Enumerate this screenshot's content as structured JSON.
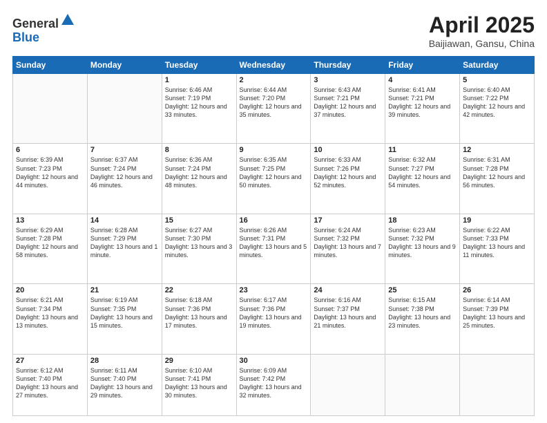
{
  "header": {
    "logo_general": "General",
    "logo_blue": "Blue",
    "month_title": "April 2025",
    "location": "Baijiawan, Gansu, China"
  },
  "weekdays": [
    "Sunday",
    "Monday",
    "Tuesday",
    "Wednesday",
    "Thursday",
    "Friday",
    "Saturday"
  ],
  "weeks": [
    [
      {
        "day": "",
        "sunrise": "",
        "sunset": "",
        "daylight": ""
      },
      {
        "day": "",
        "sunrise": "",
        "sunset": "",
        "daylight": ""
      },
      {
        "day": "1",
        "sunrise": "Sunrise: 6:46 AM",
        "sunset": "Sunset: 7:19 PM",
        "daylight": "Daylight: 12 hours and 33 minutes."
      },
      {
        "day": "2",
        "sunrise": "Sunrise: 6:44 AM",
        "sunset": "Sunset: 7:20 PM",
        "daylight": "Daylight: 12 hours and 35 minutes."
      },
      {
        "day": "3",
        "sunrise": "Sunrise: 6:43 AM",
        "sunset": "Sunset: 7:21 PM",
        "daylight": "Daylight: 12 hours and 37 minutes."
      },
      {
        "day": "4",
        "sunrise": "Sunrise: 6:41 AM",
        "sunset": "Sunset: 7:21 PM",
        "daylight": "Daylight: 12 hours and 39 minutes."
      },
      {
        "day": "5",
        "sunrise": "Sunrise: 6:40 AM",
        "sunset": "Sunset: 7:22 PM",
        "daylight": "Daylight: 12 hours and 42 minutes."
      }
    ],
    [
      {
        "day": "6",
        "sunrise": "Sunrise: 6:39 AM",
        "sunset": "Sunset: 7:23 PM",
        "daylight": "Daylight: 12 hours and 44 minutes."
      },
      {
        "day": "7",
        "sunrise": "Sunrise: 6:37 AM",
        "sunset": "Sunset: 7:24 PM",
        "daylight": "Daylight: 12 hours and 46 minutes."
      },
      {
        "day": "8",
        "sunrise": "Sunrise: 6:36 AM",
        "sunset": "Sunset: 7:24 PM",
        "daylight": "Daylight: 12 hours and 48 minutes."
      },
      {
        "day": "9",
        "sunrise": "Sunrise: 6:35 AM",
        "sunset": "Sunset: 7:25 PM",
        "daylight": "Daylight: 12 hours and 50 minutes."
      },
      {
        "day": "10",
        "sunrise": "Sunrise: 6:33 AM",
        "sunset": "Sunset: 7:26 PM",
        "daylight": "Daylight: 12 hours and 52 minutes."
      },
      {
        "day": "11",
        "sunrise": "Sunrise: 6:32 AM",
        "sunset": "Sunset: 7:27 PM",
        "daylight": "Daylight: 12 hours and 54 minutes."
      },
      {
        "day": "12",
        "sunrise": "Sunrise: 6:31 AM",
        "sunset": "Sunset: 7:28 PM",
        "daylight": "Daylight: 12 hours and 56 minutes."
      }
    ],
    [
      {
        "day": "13",
        "sunrise": "Sunrise: 6:29 AM",
        "sunset": "Sunset: 7:28 PM",
        "daylight": "Daylight: 12 hours and 58 minutes."
      },
      {
        "day": "14",
        "sunrise": "Sunrise: 6:28 AM",
        "sunset": "Sunset: 7:29 PM",
        "daylight": "Daylight: 13 hours and 1 minute."
      },
      {
        "day": "15",
        "sunrise": "Sunrise: 6:27 AM",
        "sunset": "Sunset: 7:30 PM",
        "daylight": "Daylight: 13 hours and 3 minutes."
      },
      {
        "day": "16",
        "sunrise": "Sunrise: 6:26 AM",
        "sunset": "Sunset: 7:31 PM",
        "daylight": "Daylight: 13 hours and 5 minutes."
      },
      {
        "day": "17",
        "sunrise": "Sunrise: 6:24 AM",
        "sunset": "Sunset: 7:32 PM",
        "daylight": "Daylight: 13 hours and 7 minutes."
      },
      {
        "day": "18",
        "sunrise": "Sunrise: 6:23 AM",
        "sunset": "Sunset: 7:32 PM",
        "daylight": "Daylight: 13 hours and 9 minutes."
      },
      {
        "day": "19",
        "sunrise": "Sunrise: 6:22 AM",
        "sunset": "Sunset: 7:33 PM",
        "daylight": "Daylight: 13 hours and 11 minutes."
      }
    ],
    [
      {
        "day": "20",
        "sunrise": "Sunrise: 6:21 AM",
        "sunset": "Sunset: 7:34 PM",
        "daylight": "Daylight: 13 hours and 13 minutes."
      },
      {
        "day": "21",
        "sunrise": "Sunrise: 6:19 AM",
        "sunset": "Sunset: 7:35 PM",
        "daylight": "Daylight: 13 hours and 15 minutes."
      },
      {
        "day": "22",
        "sunrise": "Sunrise: 6:18 AM",
        "sunset": "Sunset: 7:36 PM",
        "daylight": "Daylight: 13 hours and 17 minutes."
      },
      {
        "day": "23",
        "sunrise": "Sunrise: 6:17 AM",
        "sunset": "Sunset: 7:36 PM",
        "daylight": "Daylight: 13 hours and 19 minutes."
      },
      {
        "day": "24",
        "sunrise": "Sunrise: 6:16 AM",
        "sunset": "Sunset: 7:37 PM",
        "daylight": "Daylight: 13 hours and 21 minutes."
      },
      {
        "day": "25",
        "sunrise": "Sunrise: 6:15 AM",
        "sunset": "Sunset: 7:38 PM",
        "daylight": "Daylight: 13 hours and 23 minutes."
      },
      {
        "day": "26",
        "sunrise": "Sunrise: 6:14 AM",
        "sunset": "Sunset: 7:39 PM",
        "daylight": "Daylight: 13 hours and 25 minutes."
      }
    ],
    [
      {
        "day": "27",
        "sunrise": "Sunrise: 6:12 AM",
        "sunset": "Sunset: 7:40 PM",
        "daylight": "Daylight: 13 hours and 27 minutes."
      },
      {
        "day": "28",
        "sunrise": "Sunrise: 6:11 AM",
        "sunset": "Sunset: 7:40 PM",
        "daylight": "Daylight: 13 hours and 29 minutes."
      },
      {
        "day": "29",
        "sunrise": "Sunrise: 6:10 AM",
        "sunset": "Sunset: 7:41 PM",
        "daylight": "Daylight: 13 hours and 30 minutes."
      },
      {
        "day": "30",
        "sunrise": "Sunrise: 6:09 AM",
        "sunset": "Sunset: 7:42 PM",
        "daylight": "Daylight: 13 hours and 32 minutes."
      },
      {
        "day": "",
        "sunrise": "",
        "sunset": "",
        "daylight": ""
      },
      {
        "day": "",
        "sunrise": "",
        "sunset": "",
        "daylight": ""
      },
      {
        "day": "",
        "sunrise": "",
        "sunset": "",
        "daylight": ""
      }
    ]
  ]
}
